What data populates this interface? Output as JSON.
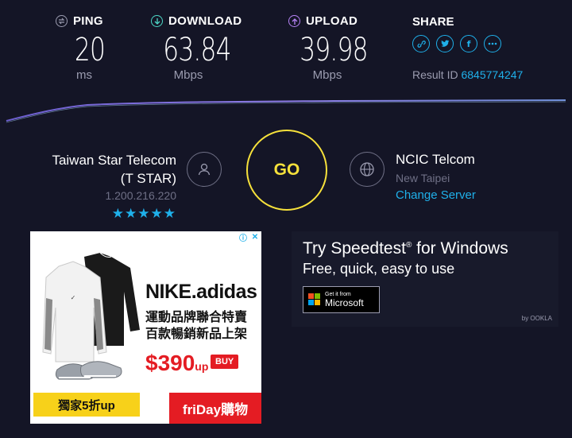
{
  "metrics": {
    "ping": {
      "label": "PING",
      "value": "20",
      "unit": "ms"
    },
    "download": {
      "label": "DOWNLOAD",
      "value": "63.84",
      "unit": "Mbps"
    },
    "upload": {
      "label": "UPLOAD",
      "value": "39.98",
      "unit": "Mbps"
    }
  },
  "share": {
    "label": "SHARE",
    "result_label": "Result ID",
    "result_id": "6845774247",
    "buttons": [
      "link-icon",
      "twitter-icon",
      "facebook-icon",
      "more-icon"
    ]
  },
  "isp": {
    "name_line1": "Taiwan Star Telecom",
    "name_line2": "(T STAR)",
    "ip": "1.200.216.220",
    "stars": "★★★★★"
  },
  "go_label": "GO",
  "server": {
    "name": "NCIC Telcom",
    "location": "New Taipei",
    "change_label": "Change Server"
  },
  "ad_left": {
    "title": "NIKE.adidas",
    "line1": "運動品牌聯合特賣",
    "line2": "百款暢銷新品上架",
    "price": "$390",
    "price_suffix": "up",
    "buy": "BUY",
    "promo": "獨家5折up",
    "brand": "friDay購物"
  },
  "ad_right": {
    "title": "Try Speedtest",
    "reg": "®",
    "title_rest": " for Windows",
    "subtitle": "Free, quick, easy to use",
    "store_small": "Get it from",
    "store_big": "Microsoft",
    "by": "by OOKLA"
  },
  "colors": {
    "accent": "#1fb0ea",
    "go": "#f6e13b",
    "download_icon": "#4cd7c6",
    "upload_icon": "#b682f5",
    "background": "#141526"
  }
}
